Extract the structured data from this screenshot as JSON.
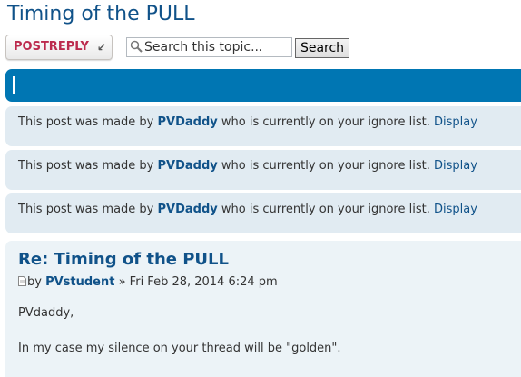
{
  "topic": {
    "title": "Timing of the PULL"
  },
  "action_bar": {
    "post_reply_label": "POSTREPLY",
    "search_placeholder": "Search this topic...",
    "search_button_label": "Search"
  },
  "ignored_posts": [
    {
      "prefix": "This post was made by ",
      "user": "PVDaddy",
      "suffix": " who is currently on your ignore list. ",
      "link": "Display"
    },
    {
      "prefix": "This post was made by ",
      "user": "PVDaddy",
      "suffix": " who is currently on your ignore list. ",
      "link": "Display"
    },
    {
      "prefix": "This post was made by ",
      "user": "PVDaddy",
      "suffix": " who is currently on your ignore list. ",
      "link": "Display"
    }
  ],
  "post": {
    "subject": "Re: Timing of the PULL",
    "by": "by ",
    "author": "PVstudent",
    "date": " » Fri Feb 28, 2014 6:24 pm",
    "body_lines": [
      "PVdaddy,",
      "In my case my silence on your thread will be \"golden\"."
    ]
  },
  "colors": {
    "link": "#105289",
    "nav_bar": "#0076b3",
    "post_bg": "#ecf3f7",
    "ignored_bg": "#e1ebf2",
    "post_reply_text": "#bc2a4d"
  }
}
